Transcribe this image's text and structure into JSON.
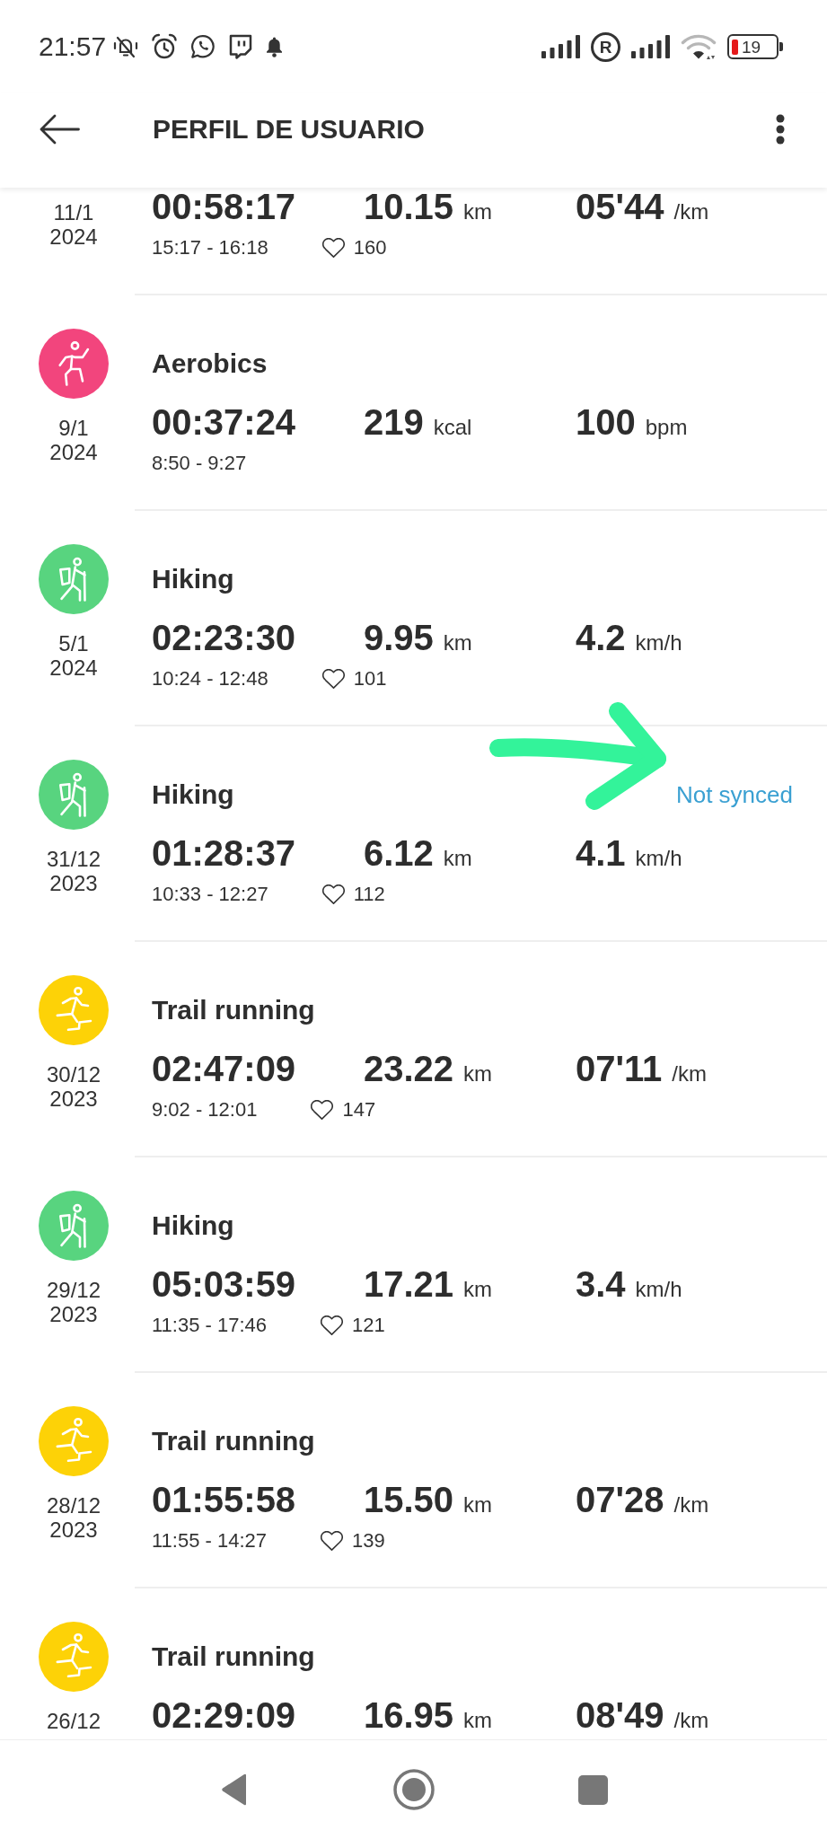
{
  "status_bar": {
    "time": "21:57",
    "roaming": "R",
    "battery": "19"
  },
  "header": {
    "title": "PERFIL DE USUARIO"
  },
  "activities": [
    {
      "date": "11/1",
      "year": "2024",
      "duration": "00:58:17",
      "stats": [
        {
          "value": "10.15",
          "unit": "km"
        },
        {
          "value": "05'44",
          "unit": "/km"
        }
      ],
      "time_range": "15:17 - 16:18",
      "heart_rate": "160"
    },
    {
      "kind": "aerobics",
      "title": "Aerobics",
      "date": "9/1",
      "year": "2024",
      "duration": "00:37:24",
      "stats": [
        {
          "value": "219",
          "unit": "kcal"
        },
        {
          "value": "100",
          "unit": "bpm"
        }
      ],
      "time_range": "8:50 - 9:27"
    },
    {
      "kind": "hiking",
      "title": "Hiking",
      "date": "5/1",
      "year": "2024",
      "duration": "02:23:30",
      "stats": [
        {
          "value": "9.95",
          "unit": "km"
        },
        {
          "value": "4.2",
          "unit": "km/h"
        }
      ],
      "time_range": "10:24 - 12:48",
      "heart_rate": "101"
    },
    {
      "kind": "hiking",
      "title": "Hiking",
      "sync_status": "Not synced",
      "date": "31/12",
      "year": "2023",
      "duration": "01:28:37",
      "stats": [
        {
          "value": "6.12",
          "unit": "km"
        },
        {
          "value": "4.1",
          "unit": "km/h"
        }
      ],
      "time_range": "10:33 - 12:27",
      "heart_rate": "112"
    },
    {
      "kind": "trail_running",
      "title": "Trail running",
      "date": "30/12",
      "year": "2023",
      "duration": "02:47:09",
      "stats": [
        {
          "value": "23.22",
          "unit": "km"
        },
        {
          "value": "07'11",
          "unit": "/km"
        }
      ],
      "time_range": "9:02 - 12:01",
      "heart_rate": "147"
    },
    {
      "kind": "hiking",
      "title": "Hiking",
      "date": "29/12",
      "year": "2023",
      "duration": "05:03:59",
      "stats": [
        {
          "value": "17.21",
          "unit": "km"
        },
        {
          "value": "3.4",
          "unit": "km/h"
        }
      ],
      "time_range": "11:35 - 17:46",
      "heart_rate": "121"
    },
    {
      "kind": "trail_running",
      "title": "Trail running",
      "date": "28/12",
      "year": "2023",
      "duration": "01:55:58",
      "stats": [
        {
          "value": "15.50",
          "unit": "km"
        },
        {
          "value": "07'28",
          "unit": "/km"
        }
      ],
      "time_range": "11:55 - 14:27",
      "heart_rate": "139"
    },
    {
      "kind": "trail_running",
      "title": "Trail running",
      "date": "26/12",
      "duration": "02:29:09",
      "stats": [
        {
          "value": "16.95",
          "unit": "km"
        },
        {
          "value": "08'49",
          "unit": "/km"
        }
      ]
    }
  ]
}
